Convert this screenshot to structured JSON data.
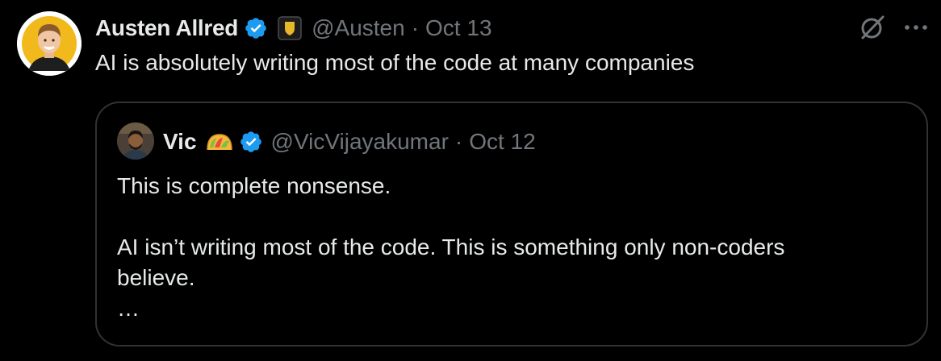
{
  "tweet": {
    "author": {
      "name": "Austen Allred",
      "handle": "@Austen",
      "verified": true,
      "affiliate_badge": "shield-badge"
    },
    "separator": "·",
    "date": "Oct 13",
    "text": "AI is absolutely writing most of the code at many companies",
    "actions": {
      "grok_icon": "grok-icon",
      "more_icon": "more-icon"
    }
  },
  "quote": {
    "author": {
      "name": "Vic",
      "emoji": "taco-emoji",
      "handle": "@VicVijayakumar",
      "verified": true
    },
    "separator": "·",
    "date": "Oct 12",
    "lines": {
      "l1": "This is complete nonsense.",
      "l2": "AI isn’t writing most of the code. This is something only non-coders",
      "l3": "believe.",
      "l4": "…"
    }
  },
  "colors": {
    "background": "#000000",
    "primary_text": "#e7e9ea",
    "secondary_text": "#71767b",
    "border": "#2f3336",
    "verified_blue": "#1d9bf0",
    "badge_gold": "#e8b829"
  }
}
